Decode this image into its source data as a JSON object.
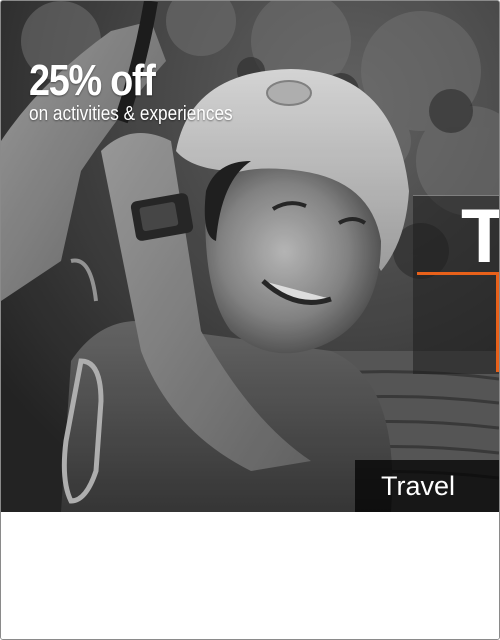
{
  "promo": {
    "headline": "25% off",
    "subline": "on activities & experiences"
  },
  "side_banner": {
    "letter": "T"
  },
  "category": {
    "label": "Travel"
  },
  "image": {
    "subject": "smiling-woman-in-helmet-ziplining",
    "style": "grayscale"
  },
  "colors": {
    "accent": "#e8611a",
    "overlay": "#000000",
    "text": "#ffffff"
  }
}
